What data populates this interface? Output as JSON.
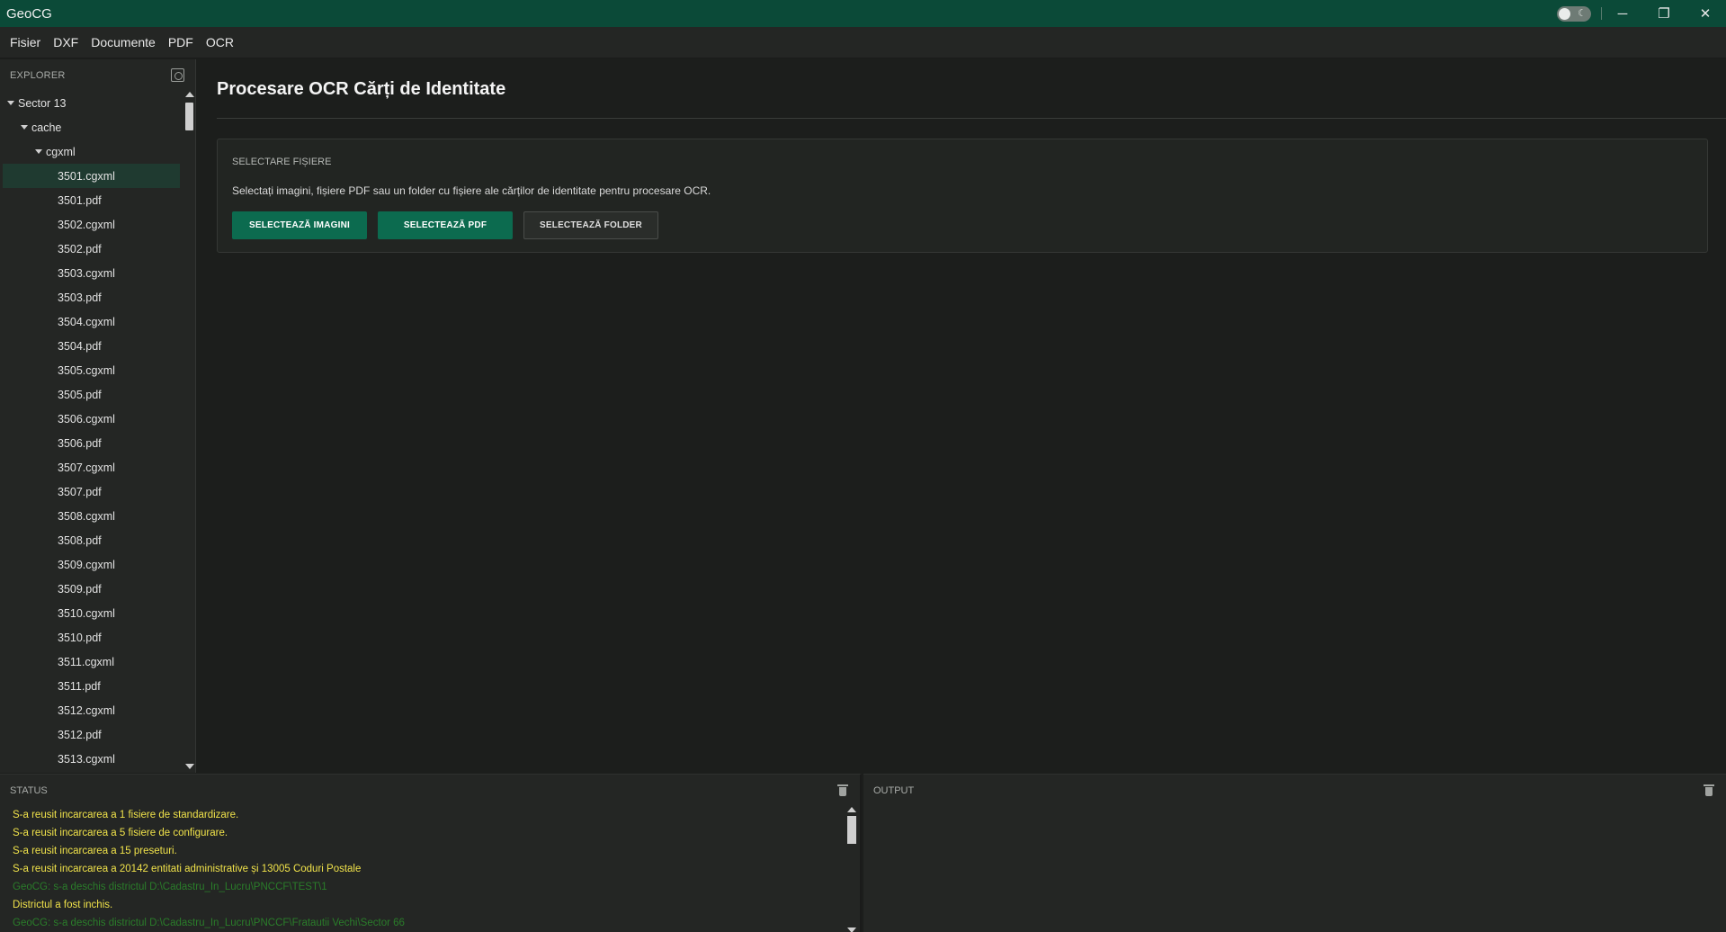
{
  "app": {
    "title": "GeoCG"
  },
  "window_controls": {
    "minimize": "─",
    "restore": "❐",
    "close": "✕",
    "moon": "☾"
  },
  "menu": [
    "Fisier",
    "DXF",
    "Documente",
    "PDF",
    "OCR"
  ],
  "explorer": {
    "header": "EXPLORER",
    "tree": [
      {
        "label": "Sector 13",
        "depth": 0,
        "expanded": true
      },
      {
        "label": "cache",
        "depth": 1,
        "expanded": true
      },
      {
        "label": "cgxml",
        "depth": 2,
        "expanded": true
      },
      {
        "label": "3501.cgxml",
        "depth": 3,
        "selected": true
      },
      {
        "label": "3501.pdf",
        "depth": 3
      },
      {
        "label": "3502.cgxml",
        "depth": 3
      },
      {
        "label": "3502.pdf",
        "depth": 3
      },
      {
        "label": "3503.cgxml",
        "depth": 3
      },
      {
        "label": "3503.pdf",
        "depth": 3
      },
      {
        "label": "3504.cgxml",
        "depth": 3
      },
      {
        "label": "3504.pdf",
        "depth": 3
      },
      {
        "label": "3505.cgxml",
        "depth": 3
      },
      {
        "label": "3505.pdf",
        "depth": 3
      },
      {
        "label": "3506.cgxml",
        "depth": 3
      },
      {
        "label": "3506.pdf",
        "depth": 3
      },
      {
        "label": "3507.cgxml",
        "depth": 3
      },
      {
        "label": "3507.pdf",
        "depth": 3
      },
      {
        "label": "3508.cgxml",
        "depth": 3
      },
      {
        "label": "3508.pdf",
        "depth": 3
      },
      {
        "label": "3509.cgxml",
        "depth": 3
      },
      {
        "label": "3509.pdf",
        "depth": 3
      },
      {
        "label": "3510.cgxml",
        "depth": 3
      },
      {
        "label": "3510.pdf",
        "depth": 3
      },
      {
        "label": "3511.cgxml",
        "depth": 3
      },
      {
        "label": "3511.pdf",
        "depth": 3
      },
      {
        "label": "3512.cgxml",
        "depth": 3
      },
      {
        "label": "3512.pdf",
        "depth": 3
      },
      {
        "label": "3513.cgxml",
        "depth": 3
      }
    ]
  },
  "main": {
    "title": "Procesare OCR Cărți de Identitate",
    "card": {
      "header": "SELECTARE FIȘIERE",
      "description": "Selectați imagini, fișiere PDF sau un folder cu fișiere ale cărților de identitate pentru procesare OCR.",
      "buttons": {
        "images": "SELECTEAZĂ IMAGINI",
        "pdf": "SELECTEAZĂ PDF",
        "folder": "SELECTEAZĂ FOLDER"
      }
    }
  },
  "status": {
    "header": "STATUS",
    "lines": [
      {
        "text": "S-a reusit incarcarea a 1 fisiere de standardizare.",
        "kind": "warn"
      },
      {
        "text": "S-a reusit incarcarea a 5 fisiere de configurare.",
        "kind": "warn"
      },
      {
        "text": "S-a reusit incarcarea a 15 preseturi.",
        "kind": "warn"
      },
      {
        "text": "S-a reusit incarcarea a 20142 entitati administrative și 13005 Coduri Postale",
        "kind": "warn"
      },
      {
        "text": "GeoCG: s-a deschis districtul D:\\Cadastru_In_Lucru\\PNCCF\\TEST\\1",
        "kind": "info"
      },
      {
        "text": "Districtul a fost inchis.",
        "kind": "warn"
      },
      {
        "text": "GeoCG: s-a deschis districtul D:\\Cadastru_In_Lucru\\PNCCF\\Fratautii Vechi\\Sector 66",
        "kind": "info"
      }
    ]
  },
  "output": {
    "header": "OUTPUT"
  },
  "colors": {
    "titlebar": "#0b4a38",
    "accent": "#0c6b4f",
    "warn": "#f0e24a",
    "info": "#2a7d2a"
  }
}
